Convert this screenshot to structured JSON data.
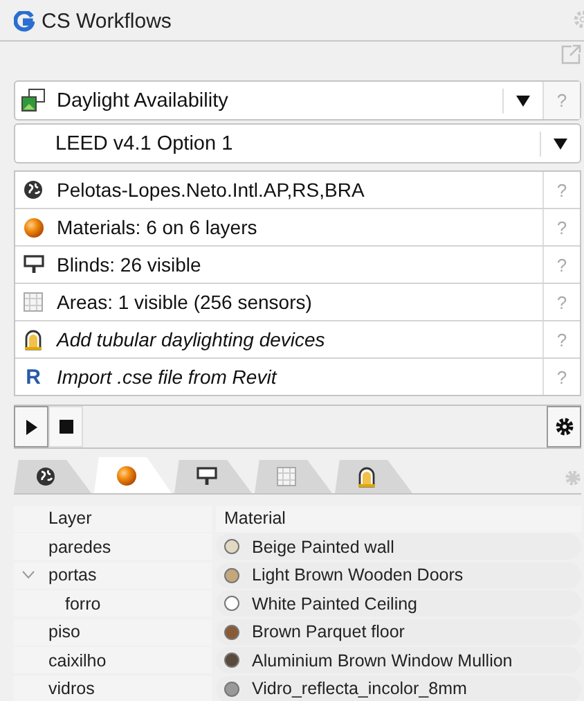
{
  "panel_tab": {
    "title": "CS Workflows"
  },
  "workflow": {
    "value": "Daylight Availability",
    "help": "?"
  },
  "option": {
    "value": "LEED v4.1 Option 1"
  },
  "items": [
    {
      "kind": "status",
      "text": "Pelotas-Lopes.Neto.Intl.AP,RS,BRA",
      "help": "?"
    },
    {
      "kind": "status",
      "text": "Materials: 6 on 6 layers",
      "help": "?"
    },
    {
      "kind": "status",
      "text": "Blinds: 26 visible",
      "help": "?"
    },
    {
      "kind": "status",
      "text": "Areas: 1 visible (256 sensors)",
      "help": "?"
    },
    {
      "kind": "action",
      "text": "Add tubular daylighting devices",
      "help": "?"
    },
    {
      "kind": "action",
      "text": "Import .cse file from Revit",
      "help": "?",
      "logo_letter": "R"
    }
  ],
  "view_tabs": [
    {
      "selected": false
    },
    {
      "selected": true
    },
    {
      "selected": false
    },
    {
      "selected": false
    },
    {
      "selected": false
    }
  ],
  "table": {
    "columns": [
      "Layer",
      "Material"
    ],
    "rows": [
      {
        "layer": "paredes",
        "material": "Beige Painted wall",
        "color": "#e2d9c3"
      },
      {
        "layer": "portas",
        "material": "Light Brown Wooden Doors",
        "color": "#c4a77b",
        "expanded": true,
        "children": [
          {
            "layer": "forro",
            "material": "White Painted Ceiling",
            "color": "#ffffff"
          }
        ]
      },
      {
        "layer": "piso",
        "material": "Brown Parquet floor",
        "color": "#8a5a35"
      },
      {
        "layer": "caixilho",
        "material": "Aluminium Brown Window Mullion",
        "color": "#5a4a3c"
      },
      {
        "layer": "vidros",
        "material": "Vidro_reflecta_incolor_8mm",
        "color": "#999999"
      }
    ]
  }
}
